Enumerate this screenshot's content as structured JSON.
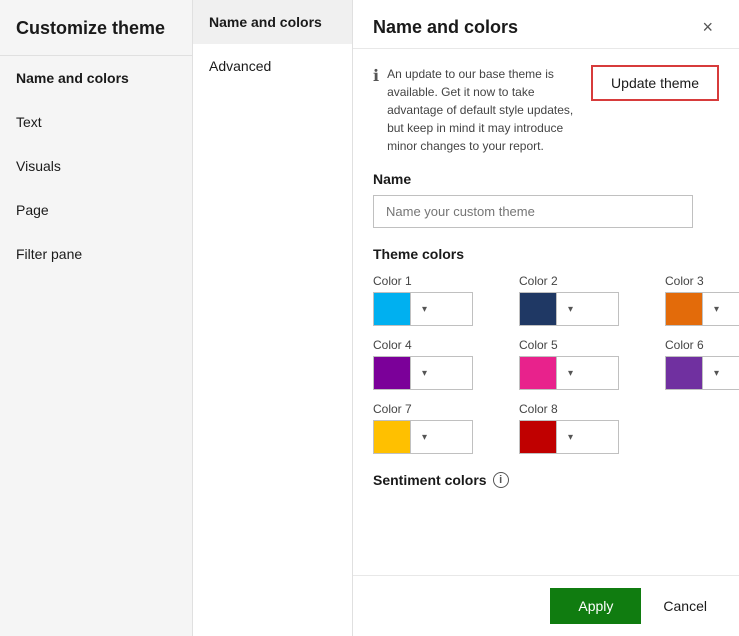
{
  "sidebar": {
    "title": "Customize theme",
    "items": [
      {
        "id": "name-and-colors",
        "label": "Name and colors",
        "active": true
      },
      {
        "id": "text",
        "label": "Text",
        "active": false
      },
      {
        "id": "visuals",
        "label": "Visuals",
        "active": false
      },
      {
        "id": "page",
        "label": "Page",
        "active": false
      },
      {
        "id": "filter-pane",
        "label": "Filter pane",
        "active": false
      }
    ]
  },
  "center_panel": {
    "tabs": [
      {
        "id": "name-and-colors",
        "label": "Name and colors",
        "active": true
      },
      {
        "id": "advanced",
        "label": "Advanced",
        "active": false
      }
    ]
  },
  "main": {
    "title": "Name and colors",
    "close_label": "×",
    "info_text": "An update to our base theme is available. Get it now to take advantage of default style updates, but keep in mind it may introduce minor changes to your report.",
    "update_theme_label": "Update theme",
    "name_section": {
      "label": "Name",
      "input_placeholder": "Name your custom theme",
      "input_value": ""
    },
    "theme_colors": {
      "label": "Theme colors",
      "colors": [
        {
          "id": "color1",
          "label": "Color 1",
          "hex": "#00B0F0"
        },
        {
          "id": "color2",
          "label": "Color 2",
          "hex": "#1F3864"
        },
        {
          "id": "color3",
          "label": "Color 3",
          "hex": "#E36B0A"
        },
        {
          "id": "color4",
          "label": "Color 4",
          "hex": "#7B0099"
        },
        {
          "id": "color5",
          "label": "Color 5",
          "hex": "#E8228C"
        },
        {
          "id": "color6",
          "label": "Color 6",
          "hex": "#7030A0"
        },
        {
          "id": "color7",
          "label": "Color 7",
          "hex": "#FFC000"
        },
        {
          "id": "color8",
          "label": "Color 8",
          "hex": "#C00000"
        }
      ]
    },
    "sentiment_colors": {
      "label": "Sentiment colors",
      "info_icon": "i"
    },
    "footer": {
      "apply_label": "Apply",
      "cancel_label": "Cancel"
    }
  }
}
